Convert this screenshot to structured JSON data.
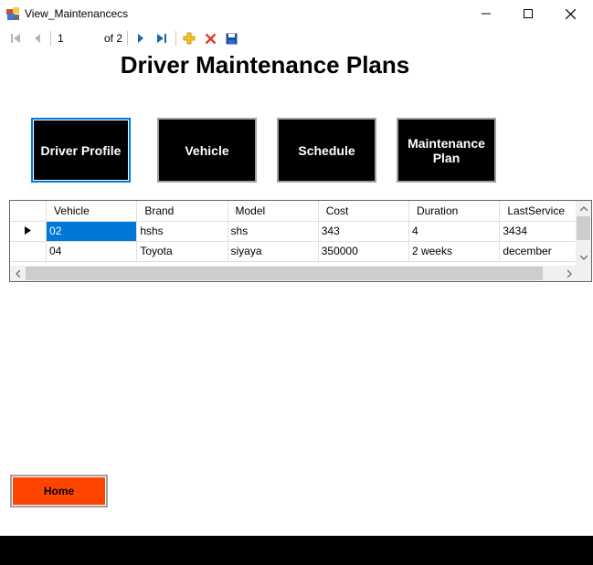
{
  "window": {
    "title": "View_Maintenancecs"
  },
  "toolbar": {
    "position": "1",
    "count_text": "of 2",
    "icons": [
      "move-first-icon",
      "move-previous-icon",
      "move-next-icon",
      "move-last-icon",
      "add-new-icon",
      "delete-icon",
      "save-icon"
    ]
  },
  "page": {
    "title": "Driver Maintenance Plans"
  },
  "nav": {
    "driver_profile": "Driver Profile",
    "vehicle": "Vehicle",
    "schedule": "Schedule",
    "maintenance_plan": "Maintenance Plan"
  },
  "grid": {
    "columns": [
      "Vehicle",
      "Brand",
      "Model",
      "Cost",
      "Duration",
      "LastService"
    ],
    "rows": [
      {
        "current": true,
        "cells": [
          "02",
          "hshs",
          "shs",
          "343",
          "4",
          "3434"
        ]
      },
      {
        "current": false,
        "cells": [
          "04",
          "Toyota",
          "siyaya",
          "350000",
          "2 weeks",
          "december"
        ]
      }
    ]
  },
  "home": {
    "label": "Home"
  },
  "colors": {
    "home_button": "#ff4500",
    "nav_button": "#000000",
    "selection": "#0078d7"
  }
}
